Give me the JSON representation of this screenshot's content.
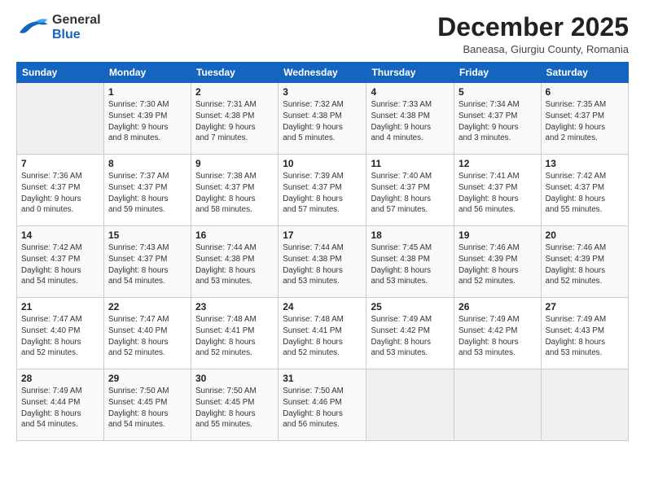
{
  "header": {
    "logo_general": "General",
    "logo_blue": "Blue",
    "month_title": "December 2025",
    "subtitle": "Baneasa, Giurgiu County, Romania"
  },
  "days_of_week": [
    "Sunday",
    "Monday",
    "Tuesday",
    "Wednesday",
    "Thursday",
    "Friday",
    "Saturday"
  ],
  "weeks": [
    [
      {
        "day": "",
        "detail": ""
      },
      {
        "day": "1",
        "detail": "Sunrise: 7:30 AM\nSunset: 4:39 PM\nDaylight: 9 hours\nand 8 minutes."
      },
      {
        "day": "2",
        "detail": "Sunrise: 7:31 AM\nSunset: 4:38 PM\nDaylight: 9 hours\nand 7 minutes."
      },
      {
        "day": "3",
        "detail": "Sunrise: 7:32 AM\nSunset: 4:38 PM\nDaylight: 9 hours\nand 5 minutes."
      },
      {
        "day": "4",
        "detail": "Sunrise: 7:33 AM\nSunset: 4:38 PM\nDaylight: 9 hours\nand 4 minutes."
      },
      {
        "day": "5",
        "detail": "Sunrise: 7:34 AM\nSunset: 4:37 PM\nDaylight: 9 hours\nand 3 minutes."
      },
      {
        "day": "6",
        "detail": "Sunrise: 7:35 AM\nSunset: 4:37 PM\nDaylight: 9 hours\nand 2 minutes."
      }
    ],
    [
      {
        "day": "7",
        "detail": "Sunrise: 7:36 AM\nSunset: 4:37 PM\nDaylight: 9 hours\nand 0 minutes."
      },
      {
        "day": "8",
        "detail": "Sunrise: 7:37 AM\nSunset: 4:37 PM\nDaylight: 8 hours\nand 59 minutes."
      },
      {
        "day": "9",
        "detail": "Sunrise: 7:38 AM\nSunset: 4:37 PM\nDaylight: 8 hours\nand 58 minutes."
      },
      {
        "day": "10",
        "detail": "Sunrise: 7:39 AM\nSunset: 4:37 PM\nDaylight: 8 hours\nand 57 minutes."
      },
      {
        "day": "11",
        "detail": "Sunrise: 7:40 AM\nSunset: 4:37 PM\nDaylight: 8 hours\nand 57 minutes."
      },
      {
        "day": "12",
        "detail": "Sunrise: 7:41 AM\nSunset: 4:37 PM\nDaylight: 8 hours\nand 56 minutes."
      },
      {
        "day": "13",
        "detail": "Sunrise: 7:42 AM\nSunset: 4:37 PM\nDaylight: 8 hours\nand 55 minutes."
      }
    ],
    [
      {
        "day": "14",
        "detail": "Sunrise: 7:42 AM\nSunset: 4:37 PM\nDaylight: 8 hours\nand 54 minutes."
      },
      {
        "day": "15",
        "detail": "Sunrise: 7:43 AM\nSunset: 4:37 PM\nDaylight: 8 hours\nand 54 minutes."
      },
      {
        "day": "16",
        "detail": "Sunrise: 7:44 AM\nSunset: 4:38 PM\nDaylight: 8 hours\nand 53 minutes."
      },
      {
        "day": "17",
        "detail": "Sunrise: 7:44 AM\nSunset: 4:38 PM\nDaylight: 8 hours\nand 53 minutes."
      },
      {
        "day": "18",
        "detail": "Sunrise: 7:45 AM\nSunset: 4:38 PM\nDaylight: 8 hours\nand 53 minutes."
      },
      {
        "day": "19",
        "detail": "Sunrise: 7:46 AM\nSunset: 4:39 PM\nDaylight: 8 hours\nand 52 minutes."
      },
      {
        "day": "20",
        "detail": "Sunrise: 7:46 AM\nSunset: 4:39 PM\nDaylight: 8 hours\nand 52 minutes."
      }
    ],
    [
      {
        "day": "21",
        "detail": "Sunrise: 7:47 AM\nSunset: 4:40 PM\nDaylight: 8 hours\nand 52 minutes."
      },
      {
        "day": "22",
        "detail": "Sunrise: 7:47 AM\nSunset: 4:40 PM\nDaylight: 8 hours\nand 52 minutes."
      },
      {
        "day": "23",
        "detail": "Sunrise: 7:48 AM\nSunset: 4:41 PM\nDaylight: 8 hours\nand 52 minutes."
      },
      {
        "day": "24",
        "detail": "Sunrise: 7:48 AM\nSunset: 4:41 PM\nDaylight: 8 hours\nand 52 minutes."
      },
      {
        "day": "25",
        "detail": "Sunrise: 7:49 AM\nSunset: 4:42 PM\nDaylight: 8 hours\nand 53 minutes."
      },
      {
        "day": "26",
        "detail": "Sunrise: 7:49 AM\nSunset: 4:42 PM\nDaylight: 8 hours\nand 53 minutes."
      },
      {
        "day": "27",
        "detail": "Sunrise: 7:49 AM\nSunset: 4:43 PM\nDaylight: 8 hours\nand 53 minutes."
      }
    ],
    [
      {
        "day": "28",
        "detail": "Sunrise: 7:49 AM\nSunset: 4:44 PM\nDaylight: 8 hours\nand 54 minutes."
      },
      {
        "day": "29",
        "detail": "Sunrise: 7:50 AM\nSunset: 4:45 PM\nDaylight: 8 hours\nand 54 minutes."
      },
      {
        "day": "30",
        "detail": "Sunrise: 7:50 AM\nSunset: 4:45 PM\nDaylight: 8 hours\nand 55 minutes."
      },
      {
        "day": "31",
        "detail": "Sunrise: 7:50 AM\nSunset: 4:46 PM\nDaylight: 8 hours\nand 56 minutes."
      },
      {
        "day": "",
        "detail": ""
      },
      {
        "day": "",
        "detail": ""
      },
      {
        "day": "",
        "detail": ""
      }
    ]
  ]
}
